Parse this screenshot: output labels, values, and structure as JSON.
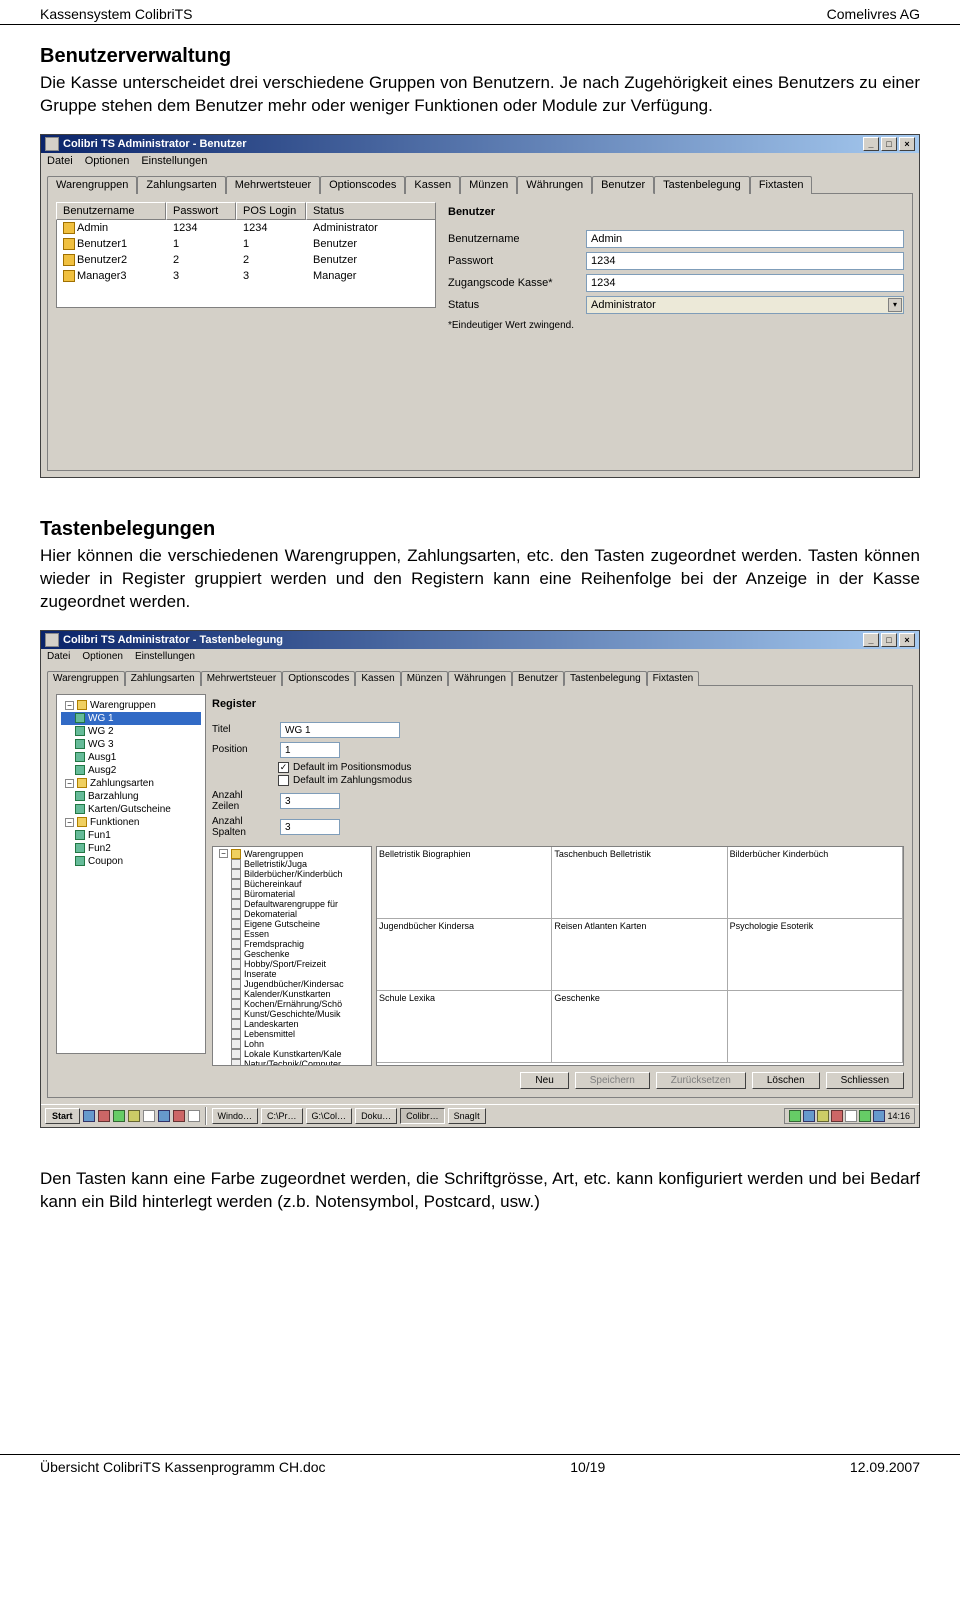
{
  "header": {
    "left": "Kassensystem ColibriTS",
    "right": "Comelivres AG"
  },
  "sec1": {
    "title": "Benutzerverwaltung",
    "text": "Die Kasse unterscheidet drei verschiedene Gruppen von Benutzern. Je nach Zugehörigkeit eines Benutzers zu einer Gruppe stehen dem Benutzer mehr oder weniger Funktionen oder Module zur Verfügung."
  },
  "win1": {
    "title": "Colibri TS Administrator - Benutzer",
    "menus": [
      "Datei",
      "Optionen",
      "Einstellungen"
    ],
    "tabs": [
      "Warengruppen",
      "Zahlungsarten",
      "Mehrwertsteuer",
      "Optionscodes",
      "Kassen",
      "Münzen",
      "Währungen",
      "Benutzer",
      "Tastenbelegung",
      "Fixtasten"
    ],
    "activeTab": "Benutzer",
    "listHeaders": [
      "Benutzername",
      "Passwort",
      "POS Login",
      "Status"
    ],
    "rows": [
      {
        "name": "Admin",
        "pw": "1234",
        "pos": "1234",
        "status": "Administrator"
      },
      {
        "name": "Benutzer1",
        "pw": "1",
        "pos": "1",
        "status": "Benutzer"
      },
      {
        "name": "Benutzer2",
        "pw": "2",
        "pos": "2",
        "status": "Benutzer"
      },
      {
        "name": "Manager3",
        "pw": "3",
        "pos": "3",
        "status": "Manager"
      }
    ],
    "panelHeading": "Benutzer",
    "fields": {
      "benutzername_label": "Benutzername",
      "benutzername": "Admin",
      "passwort_label": "Passwort",
      "passwort": "1234",
      "zugang_label": "Zugangscode Kasse*",
      "zugang": "1234",
      "status_label": "Status",
      "status": "Administrator"
    },
    "footnote": "*Eindeutiger Wert zwingend."
  },
  "sec2": {
    "title": "Tastenbelegungen",
    "text": "Hier können die verschiedenen Warengruppen, Zahlungsarten, etc. den Tasten zugeordnet werden. Tasten können wieder in Register gruppiert werden und den Registern kann eine Reihenfolge bei der Anzeige in der Kasse zugeordnet werden."
  },
  "win2": {
    "title": "Colibri TS Administrator - Tastenbelegung",
    "menus": [
      "Datei",
      "Optionen",
      "Einstellungen"
    ],
    "tabs": [
      "Warengruppen",
      "Zahlungsarten",
      "Mehrwertsteuer",
      "Optionscodes",
      "Kassen",
      "Münzen",
      "Währungen",
      "Benutzer",
      "Tastenbelegung",
      "Fixtasten"
    ],
    "activeTab": "Tastenbelegung",
    "tree": {
      "root": [
        {
          "label": "Warengruppen",
          "exp": true,
          "children": [
            {
              "label": "WG 1",
              "sel": true
            },
            {
              "label": "WG 2"
            },
            {
              "label": "WG 3"
            },
            {
              "label": "Ausg1"
            },
            {
              "label": "Ausg2"
            }
          ]
        },
        {
          "label": "Zahlungsarten",
          "exp": true,
          "children": [
            {
              "label": "Barzahlung"
            },
            {
              "label": "Karten/Gutscheine"
            }
          ]
        },
        {
          "label": "Funktionen",
          "exp": true,
          "children": [
            {
              "label": "Fun1"
            },
            {
              "label": "Fun2"
            }
          ]
        },
        {
          "label": "Coupon"
        }
      ]
    },
    "register": {
      "heading": "Register",
      "titel_label": "Titel",
      "titel": "WG 1",
      "position_label": "Position",
      "position": "1",
      "chk1": "Default im Positionsmodus",
      "chk1_on": true,
      "chk2": "Default im Zahlungsmodus",
      "chk2_on": false,
      "zeilen_label": "Anzahl Zeilen",
      "zeilen": "3",
      "spalten_label": "Anzahl Spalten",
      "spalten": "3"
    },
    "catalog": {
      "root": "Warengruppen",
      "items": [
        "Belletristik/Juga",
        "Bilderbücher/Kinderbüch",
        "Büchereinkauf",
        "Büromaterial",
        "Defaultwarengruppe für",
        "Dekomaterial",
        "Eigene Gutscheine",
        "Essen",
        "Fremdsprachig",
        "Geschenke",
        "Hobby/Sport/Freizeit",
        "Inserate",
        "Jugendbücher/Kindersac",
        "Kalender/Kunstkarten",
        "Kochen/Ernährung/Schö",
        "Kunst/Geschichte/Musik",
        "Landeskarten",
        "Lebensmittel",
        "Lohn",
        "Lokale Kunstkarten/Kale",
        "Natur/Technik/Computer"
      ]
    },
    "grid": [
      [
        "Belletristik Biographien",
        "Taschenbuch Belletristik",
        "Bilderbücher Kinderbüch"
      ],
      [
        "Jugendbücher Kindersa",
        "Reisen Atlanten Karten",
        "Psychologie Esoterik"
      ],
      [
        "Schule Lexika",
        "Geschenke",
        ""
      ]
    ],
    "buttons": {
      "neu": "Neu",
      "speichern": "Speichern",
      "zuruck": "Zurücksetzen",
      "loeschen": "Löschen",
      "schliessen": "Schliessen"
    },
    "taskbar": {
      "start": "Start",
      "items": [
        "Windo…",
        "C:\\Pr…",
        "G:\\Col…",
        "Doku…",
        "Colibr…",
        "SnagIt"
      ],
      "time": "14:16"
    }
  },
  "sec3": {
    "text": "Den Tasten kann eine Farbe zugeordnet werden, die Schriftgrösse, Art, etc. kann konfiguriert werden und bei Bedarf kann ein Bild hinterlegt werden (z.b. Notensymbol, Postcard, usw.)"
  },
  "footer": {
    "left": "Übersicht ColibriTS Kassenprogramm CH.doc",
    "center": "10/19",
    "right": "12.09.2007"
  }
}
